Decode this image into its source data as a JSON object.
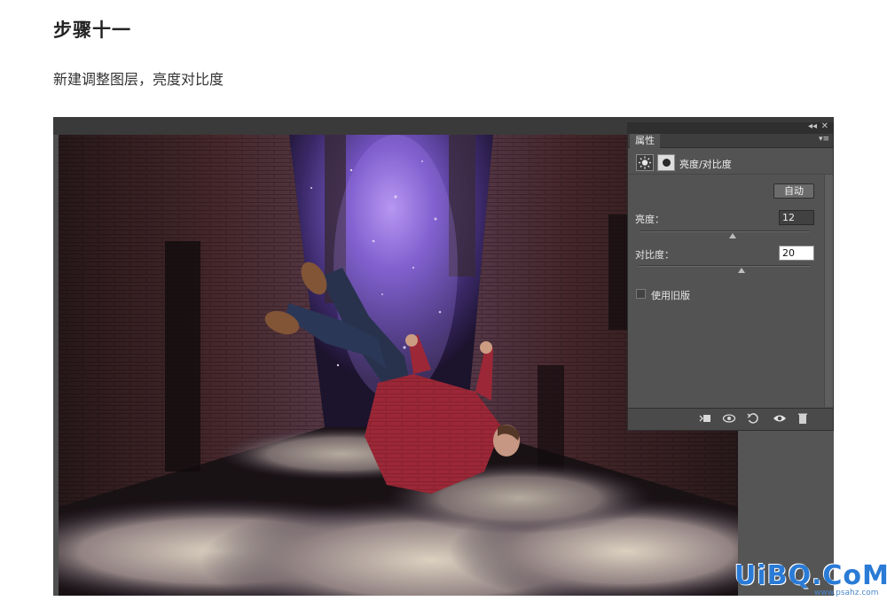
{
  "article": {
    "step_title": "步骤十一",
    "step_desc": "新建调整图层，亮度对比度"
  },
  "panel": {
    "collapse_glyph": "◂◂",
    "close_glyph": "✕",
    "tab_label": "属性",
    "menu_glyph": "▾≡",
    "adjustment_name": "亮度/对比度",
    "auto_button": "自动",
    "brightness": {
      "label": "亮度：",
      "value": "12",
      "level": 0.55
    },
    "contrast": {
      "label": "对比度：",
      "value": "20",
      "level": 0.6
    },
    "legacy_checkbox": {
      "label": "使用旧版",
      "checked": false
    },
    "bottom_icons": [
      "clip-to-layer-icon",
      "view-previous-state-icon",
      "reset-icon",
      "visibility-eye-icon",
      "trash-icon"
    ]
  },
  "watermark": {
    "logo_text": "UiBQ.CoM",
    "site_text": "www.psahz.com"
  },
  "colors": {
    "panel_bg": "#535353",
    "watermark_blue": "#2a7bd6"
  }
}
